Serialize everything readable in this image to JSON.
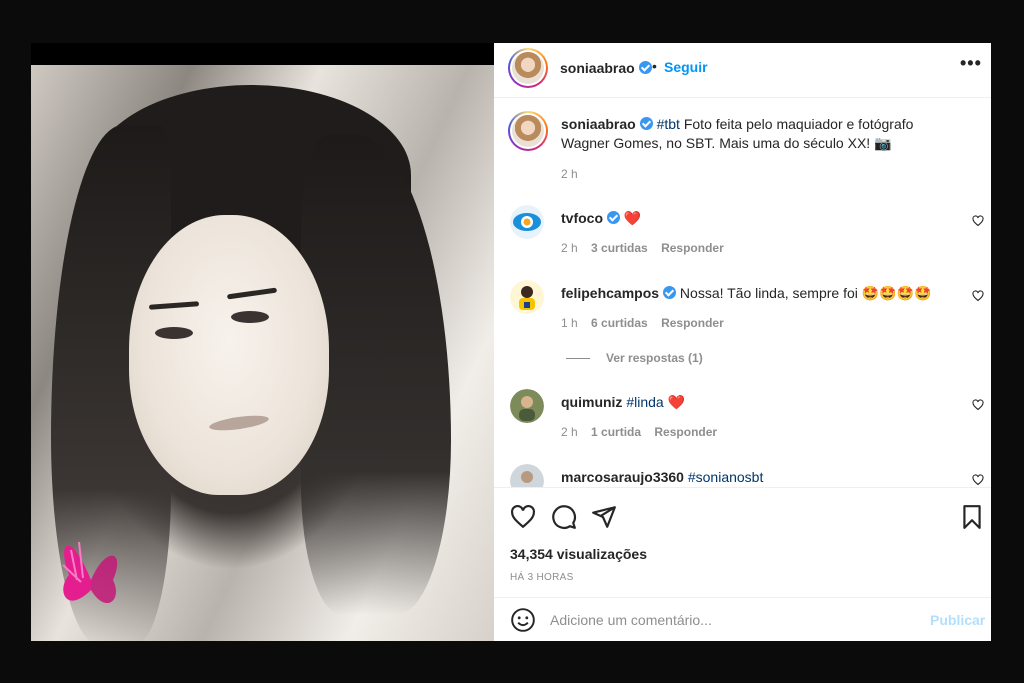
{
  "post": {
    "username": "soniaabrao",
    "dot": "•",
    "follow_label": "Seguir",
    "more_label": "•••"
  },
  "caption": {
    "username": "soniaabrao",
    "hashtag": "#tbt",
    "text": "Foto feita pelo maquiador e fotógrafo Wagner Gomes, no SBT. Mais uma do século XX!",
    "emoji": "📷",
    "time": "2 h"
  },
  "comments": [
    {
      "username": "tvfoco",
      "text": "",
      "emoji": "❤️",
      "time": "2 h",
      "likes": "3 curtidas",
      "reply": "Responder"
    },
    {
      "username": "felipehcampos",
      "text": "Nossa! Tão linda, sempre foi",
      "emoji": "🤩🤩🤩🤩",
      "time": "1 h",
      "likes": "6 curtidas",
      "reply": "Responder",
      "view_replies": "Ver respostas (1)"
    },
    {
      "username": "quimuniz",
      "hashtag": "#linda",
      "emoji": "❤️",
      "time": "2 h",
      "likes": "1 curtida",
      "reply": "Responder"
    },
    {
      "username": "marcosaraujo3360",
      "hashtag": "#sonianosbt"
    }
  ],
  "stats": {
    "views": "34,354 visualizações",
    "time_ago": "HÁ 3 HORAS"
  },
  "add_comment": {
    "placeholder": "Adicione um comentário...",
    "publish_label": "Publicar"
  },
  "colors": {
    "link_blue": "#0095f6",
    "hashtag_blue": "#00376b",
    "muted_gray": "#8e8e8e",
    "publish_disabled": "#b2dffc"
  }
}
